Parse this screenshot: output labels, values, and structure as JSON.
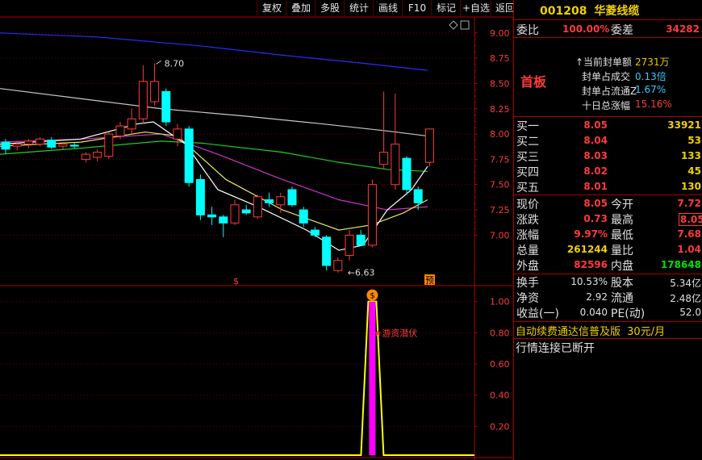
{
  "toolbar": {
    "buttons": [
      "复权",
      "叠加",
      "多股",
      "统计",
      "画线",
      "F10",
      "标记",
      "+自选",
      "返回"
    ]
  },
  "stock": {
    "code": "001208",
    "name": "华菱线缆"
  },
  "price_axis": {
    "ticks": [
      "9.00",
      "8.75",
      "8.50",
      "8.25",
      "8.00",
      "7.75",
      "7.50",
      "7.25",
      "7.00"
    ]
  },
  "indicator_axis": {
    "ticks": [
      "1.00",
      "0.80",
      "0.60",
      "0.40",
      "0.20"
    ]
  },
  "annotations": {
    "high": "8.70",
    "low": "6.63",
    "pre_mark": "预",
    "dollar_mark": "$",
    "signal_icon": "$",
    "signal_text": "★游资潜伏"
  },
  "ratio": {
    "wb_label": "委比",
    "wb_value": "100.00%",
    "wc_label": "委差",
    "wc_value": "34282"
  },
  "limit": {
    "title": "首板",
    "rows": [
      {
        "label": "当前封单额",
        "value": "2731万"
      },
      {
        "label": "封单占成交",
        "value": "0.13倍"
      },
      {
        "label": "封单占流通Z",
        "value": "1.67%"
      },
      {
        "label": "十日总涨幅",
        "value": "15.16%"
      }
    ]
  },
  "bids": [
    {
      "label": "买一",
      "price": "8.05",
      "vol": "33921"
    },
    {
      "label": "买二",
      "price": "8.04",
      "vol": "53"
    },
    {
      "label": "买三",
      "price": "8.03",
      "vol": "133"
    },
    {
      "label": "买四",
      "price": "8.02",
      "vol": "45"
    },
    {
      "label": "买五",
      "price": "8.01",
      "vol": "130"
    }
  ],
  "quote": {
    "xj_l": "现价",
    "xj": "8.05",
    "jk_l": "今开",
    "jk": "7.72",
    "zd_l": "涨跌",
    "zd": "0.73",
    "zg_l": "最高",
    "zg": "8.05",
    "zf_l": "涨幅",
    "zf": "9.97%",
    "zd2_l": "最低",
    "zd2": "7.68",
    "zl_l": "总量",
    "zl": "261244",
    "lb_l": "量比",
    "lb": "1.04",
    "wp_l": "外盘",
    "wp": "82596",
    "np_l": "内盘",
    "np": "178648"
  },
  "fundamentals": {
    "hs_l": "换手",
    "hs": "10.53%",
    "gb_l": "股本",
    "gb": "5.34亿",
    "jz_l": "净资",
    "jz": "2.92",
    "lt_l": "流通",
    "lt": "2.48亿",
    "sy_l": "收益(一)",
    "sy": "0.040",
    "pe_l": "PE(动)",
    "pe": "52.0"
  },
  "footer": {
    "ad": "自动续费通达信普及版",
    "price": "30元/月",
    "status": "行情连接已断开"
  },
  "colors": {
    "up": "#ff3b3b",
    "down": "#00ffff",
    "grid": "#aa0000"
  },
  "chart_data": {
    "type": "candlestick",
    "ylim": [
      6.5,
      9.15
    ],
    "candles": [
      {
        "o": 7.92,
        "h": 7.95,
        "l": 7.8,
        "c": 7.85
      },
      {
        "o": 7.88,
        "h": 7.92,
        "l": 7.84,
        "c": 7.9
      },
      {
        "o": 7.9,
        "h": 7.95,
        "l": 7.86,
        "c": 7.93
      },
      {
        "o": 7.9,
        "h": 7.97,
        "l": 7.88,
        "c": 7.95
      },
      {
        "o": 7.94,
        "h": 7.97,
        "l": 7.85,
        "c": 7.87
      },
      {
        "o": 7.88,
        "h": 7.92,
        "l": 7.85,
        "c": 7.9
      },
      {
        "o": 7.89,
        "h": 7.91,
        "l": 7.86,
        "c": 7.88
      },
      {
        "o": 7.75,
        "h": 7.82,
        "l": 7.72,
        "c": 7.8
      },
      {
        "o": 7.77,
        "h": 7.85,
        "l": 7.73,
        "c": 7.82
      },
      {
        "o": 7.78,
        "h": 8.02,
        "l": 7.75,
        "c": 8.0
      },
      {
        "o": 7.98,
        "h": 8.12,
        "l": 7.95,
        "c": 8.08
      },
      {
        "o": 8.05,
        "h": 8.25,
        "l": 8.0,
        "c": 8.15
      },
      {
        "o": 8.15,
        "h": 8.68,
        "l": 8.1,
        "c": 8.52
      },
      {
        "o": 8.32,
        "h": 8.7,
        "l": 8.28,
        "c": 8.52
      },
      {
        "o": 8.42,
        "h": 8.45,
        "l": 8.08,
        "c": 8.12
      },
      {
        "o": 7.95,
        "h": 8.1,
        "l": 7.88,
        "c": 8.05
      },
      {
        "o": 8.05,
        "h": 8.08,
        "l": 7.48,
        "c": 7.52
      },
      {
        "o": 7.55,
        "h": 7.6,
        "l": 7.15,
        "c": 7.2
      },
      {
        "o": 7.2,
        "h": 7.28,
        "l": 7.1,
        "c": 7.18
      },
      {
        "o": 7.18,
        "h": 7.2,
        "l": 6.98,
        "c": 7.12
      },
      {
        "o": 7.12,
        "h": 7.35,
        "l": 7.1,
        "c": 7.3
      },
      {
        "o": 7.25,
        "h": 7.3,
        "l": 7.2,
        "c": 7.22
      },
      {
        "o": 7.18,
        "h": 7.4,
        "l": 7.16,
        "c": 7.38
      },
      {
        "o": 7.35,
        "h": 7.42,
        "l": 7.28,
        "c": 7.32
      },
      {
        "o": 7.3,
        "h": 7.42,
        "l": 7.22,
        "c": 7.38
      },
      {
        "o": 7.45,
        "h": 7.48,
        "l": 7.28,
        "c": 7.3
      },
      {
        "o": 7.25,
        "h": 7.28,
        "l": 7.08,
        "c": 7.12
      },
      {
        "o": 7.05,
        "h": 7.08,
        "l": 6.98,
        "c": 7.0
      },
      {
        "o": 6.98,
        "h": 7.0,
        "l": 6.65,
        "c": 6.7
      },
      {
        "o": 6.65,
        "h": 6.78,
        "l": 6.63,
        "c": 6.75
      },
      {
        "o": 6.8,
        "h": 7.05,
        "l": 6.75,
        "c": 7.0
      },
      {
        "o": 7.0,
        "h": 7.05,
        "l": 6.9,
        "c": 6.9
      },
      {
        "o": 6.9,
        "h": 7.55,
        "l": 6.88,
        "c": 7.5
      },
      {
        "o": 7.7,
        "h": 8.42,
        "l": 7.65,
        "c": 7.82
      },
      {
        "o": 7.5,
        "h": 8.4,
        "l": 7.45,
        "c": 7.9
      },
      {
        "o": 7.76,
        "h": 7.78,
        "l": 7.4,
        "c": 7.45
      },
      {
        "o": 7.45,
        "h": 7.48,
        "l": 7.25,
        "c": 7.32
      },
      {
        "o": 7.72,
        "h": 8.05,
        "l": 7.68,
        "c": 8.05
      }
    ],
    "ma_lines": [
      {
        "color": "#2a2aff",
        "points": [
          [
            0,
            9.0
          ],
          [
            120,
            8.96
          ],
          [
            250,
            8.87
          ],
          [
            350,
            8.78
          ],
          [
            450,
            8.7
          ],
          [
            530,
            8.63
          ]
        ]
      },
      {
        "color": "#c8c8c8",
        "points": [
          [
            0,
            8.45
          ],
          [
            100,
            8.35
          ],
          [
            200,
            8.25
          ],
          [
            300,
            8.18
          ],
          [
            400,
            8.1
          ],
          [
            480,
            8.03
          ],
          [
            530,
            7.98
          ]
        ]
      },
      {
        "color": "#22cc22",
        "points": [
          [
            0,
            7.8
          ],
          [
            100,
            7.86
          ],
          [
            200,
            7.93
          ],
          [
            250,
            7.91
          ],
          [
            350,
            7.82
          ],
          [
            420,
            7.72
          ],
          [
            480,
            7.65
          ],
          [
            530,
            7.63
          ]
        ]
      },
      {
        "color": "#cc33cc",
        "points": [
          [
            0,
            7.92
          ],
          [
            100,
            7.95
          ],
          [
            200,
            8.0
          ],
          [
            270,
            7.8
          ],
          [
            350,
            7.55
          ],
          [
            420,
            7.35
          ],
          [
            480,
            7.25
          ],
          [
            530,
            7.28
          ]
        ]
      },
      {
        "color": "#e8e85a",
        "points": [
          [
            0,
            7.88
          ],
          [
            100,
            7.92
          ],
          [
            180,
            8.02
          ],
          [
            220,
            7.98
          ],
          [
            280,
            7.55
          ],
          [
            350,
            7.25
          ],
          [
            420,
            7.05
          ],
          [
            460,
            7.1
          ],
          [
            500,
            7.22
          ],
          [
            530,
            7.35
          ]
        ]
      },
      {
        "color": "#ffffff",
        "points": [
          [
            0,
            7.9
          ],
          [
            100,
            7.95
          ],
          [
            170,
            8.1
          ],
          [
            190,
            8.12
          ],
          [
            230,
            7.9
          ],
          [
            270,
            7.45
          ],
          [
            320,
            7.28
          ],
          [
            380,
            7.05
          ],
          [
            420,
            6.85
          ],
          [
            450,
            6.9
          ],
          [
            480,
            7.25
          ],
          [
            510,
            7.45
          ],
          [
            530,
            7.68
          ]
        ]
      }
    ],
    "indicator": {
      "ylim": [
        0,
        1.05
      ],
      "series": [
        {
          "spike_index": 32,
          "value": 1.0
        }
      ]
    }
  }
}
